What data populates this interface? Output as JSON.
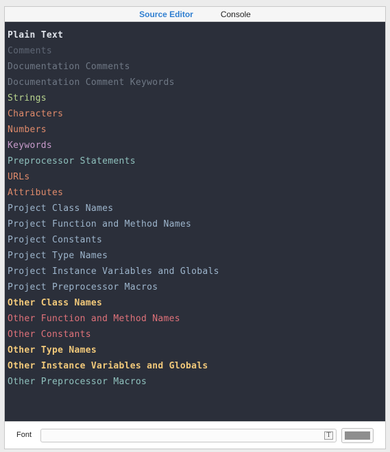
{
  "tabs": [
    {
      "label": "Source Editor",
      "active": true
    },
    {
      "label": "Console",
      "active": false
    }
  ],
  "syntax_items": [
    {
      "label": "Plain Text",
      "color": "#dfe3ea",
      "bold": true
    },
    {
      "label": "Comments",
      "color": "#5f6775",
      "bold": false
    },
    {
      "label": "Documentation Comments",
      "color": "#6f7885",
      "bold": false
    },
    {
      "label": "Documentation Comment Keywords",
      "color": "#6f7885",
      "bold": false
    },
    {
      "label": "Strings",
      "color": "#b9d58f",
      "bold": false
    },
    {
      "label": "Characters",
      "color": "#e08b6b",
      "bold": false
    },
    {
      "label": "Numbers",
      "color": "#e08b6b",
      "bold": false
    },
    {
      "label": "Keywords",
      "color": "#c89bcb",
      "bold": false
    },
    {
      "label": "Preprocessor Statements",
      "color": "#8fc1bd",
      "bold": false
    },
    {
      "label": "URLs",
      "color": "#e08b6b",
      "bold": false
    },
    {
      "label": "Attributes",
      "color": "#e08b6b",
      "bold": false
    },
    {
      "label": "Project Class Names",
      "color": "#9db5cc",
      "bold": false
    },
    {
      "label": "Project Function and Method Names",
      "color": "#9db5cc",
      "bold": false
    },
    {
      "label": "Project Constants",
      "color": "#9db5cc",
      "bold": false
    },
    {
      "label": "Project Type Names",
      "color": "#9db5cc",
      "bold": false
    },
    {
      "label": "Project Instance Variables and Globals",
      "color": "#9db5cc",
      "bold": false
    },
    {
      "label": "Project Preprocessor Macros",
      "color": "#9db5cc",
      "bold": false
    },
    {
      "label": "Other Class Names",
      "color": "#f2c97a",
      "bold": true
    },
    {
      "label": "Other Function and Method Names",
      "color": "#e0727a",
      "bold": false
    },
    {
      "label": "Other Constants",
      "color": "#e0727a",
      "bold": false
    },
    {
      "label": "Other Type Names",
      "color": "#f2c97a",
      "bold": true
    },
    {
      "label": "Other Instance Variables and Globals",
      "color": "#f2c97a",
      "bold": true
    },
    {
      "label": "Other Preprocessor Macros",
      "color": "#8fc1bd",
      "bold": false
    }
  ],
  "footer": {
    "font_label": "Font",
    "font_value": "",
    "font_picker_icon": "T",
    "color_well_color": "#8e8e8e"
  },
  "theme": {
    "editor_background": "#2b2f3a",
    "active_tab_color": "#2f7fd1"
  }
}
